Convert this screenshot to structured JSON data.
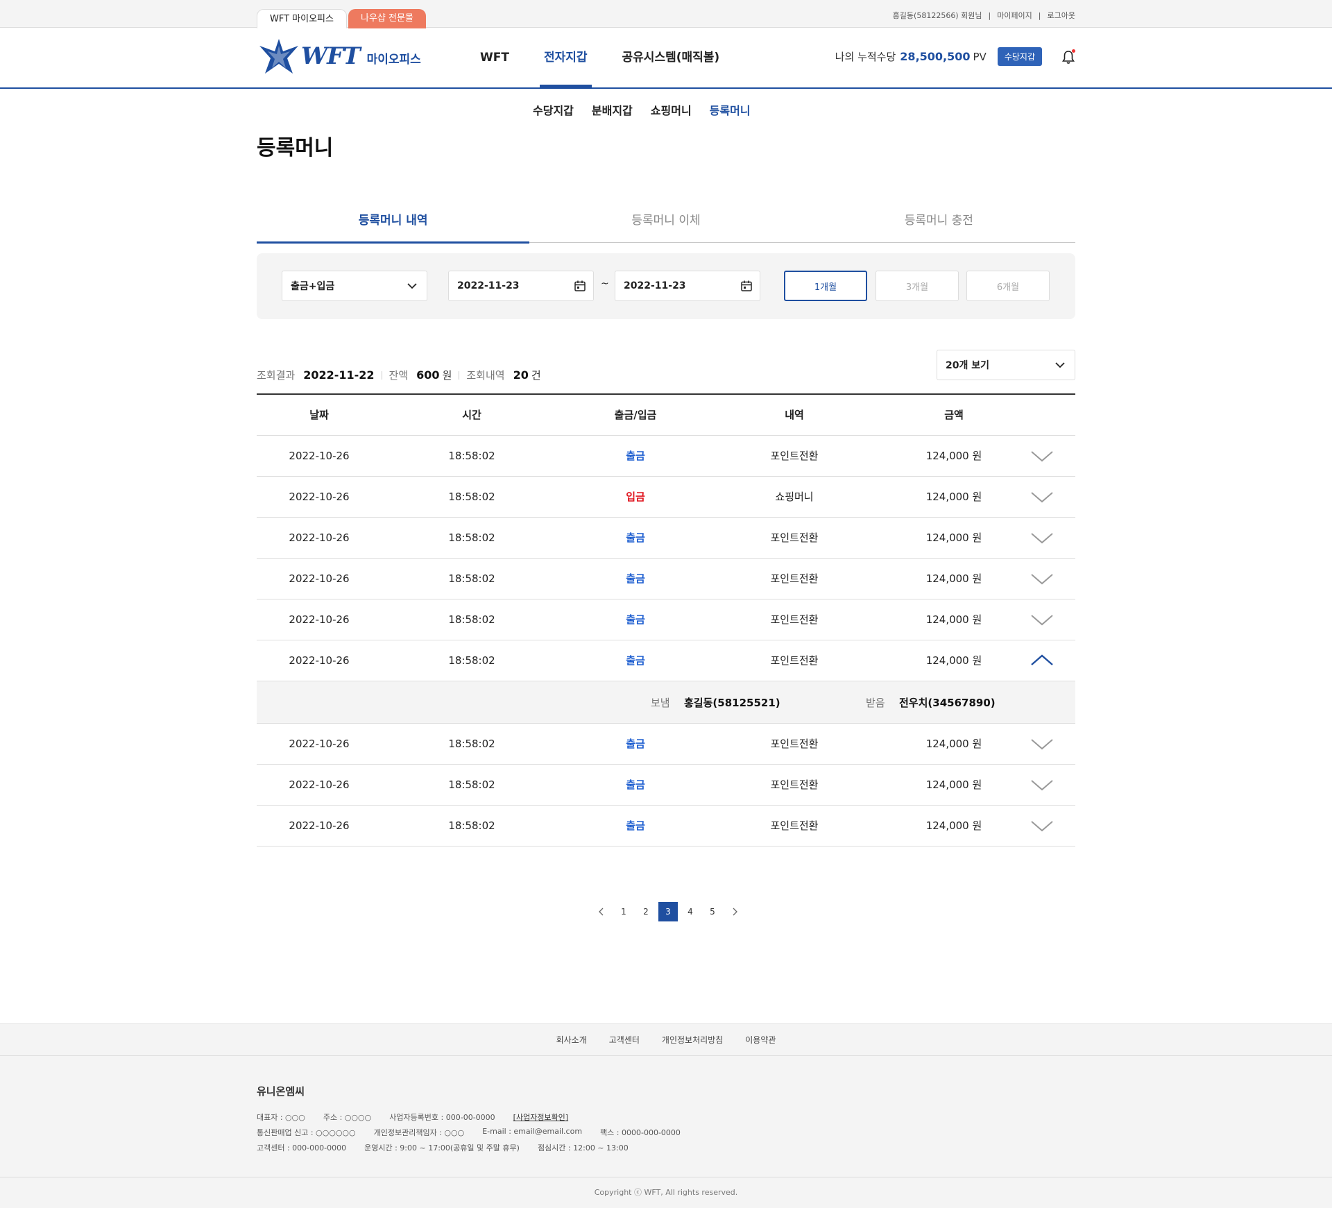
{
  "topbar": {
    "site_tabs": [
      "WFT 마이오피스",
      "나우샵 전문몰"
    ],
    "user": "홍길동(58122566) 회원님",
    "mypage": "마이페이지",
    "logout": "로그아웃"
  },
  "header": {
    "logo_word": "WFT",
    "logo_sub": "마이오피스",
    "gnb": [
      "WFT",
      "전자지갑",
      "공유시스템(매직볼)"
    ],
    "accum_label": "나의 누적수당",
    "accum_value": "28,500,500",
    "accum_unit": "PV",
    "wallet_button": "수당지갑"
  },
  "subnav": [
    "수당지갑",
    "분배지갑",
    "쇼핑머니",
    "등록머니"
  ],
  "page_title": "등록머니",
  "content_tabs": [
    "등록머니 내역",
    "등록머니 이체",
    "등록머니 충전"
  ],
  "filter": {
    "type_select": "출금+입금",
    "date_from": "2022-11-23",
    "tilde": "~",
    "date_to": "2022-11-23",
    "periods": [
      "1개월",
      "3개월",
      "6개월"
    ]
  },
  "summary": {
    "result_label": "조회결과",
    "result_date": "2022-11-22",
    "balance_label": "잔액",
    "balance_value": "600",
    "balance_unit": "원",
    "count_label": "조회내역",
    "count_value": "20",
    "count_unit": "건",
    "per_page": "20개 보기"
  },
  "table": {
    "headers": [
      "날짜",
      "시간",
      "출금/입금",
      "내역",
      "금액"
    ],
    "rows": [
      {
        "date": "2022-10-26",
        "time": "18:58:02",
        "type": "출금",
        "desc": "포인트전환",
        "amount": "124,000 원"
      },
      {
        "date": "2022-10-26",
        "time": "18:58:02",
        "type": "입금",
        "desc": "쇼핑머니",
        "amount": "124,000 원"
      },
      {
        "date": "2022-10-26",
        "time": "18:58:02",
        "type": "출금",
        "desc": "포인트전환",
        "amount": "124,000 원"
      },
      {
        "date": "2022-10-26",
        "time": "18:58:02",
        "type": "출금",
        "desc": "포인트전환",
        "amount": "124,000 원"
      },
      {
        "date": "2022-10-26",
        "time": "18:58:02",
        "type": "출금",
        "desc": "포인트전환",
        "amount": "124,000 원"
      },
      {
        "date": "2022-10-26",
        "time": "18:58:02",
        "type": "출금",
        "desc": "포인트전환",
        "amount": "124,000 원"
      },
      {
        "date": "2022-10-26",
        "time": "18:58:02",
        "type": "출금",
        "desc": "포인트전환",
        "amount": "124,000 원"
      },
      {
        "date": "2022-10-26",
        "time": "18:58:02",
        "type": "출금",
        "desc": "포인트전환",
        "amount": "124,000 원"
      },
      {
        "date": "2022-10-26",
        "time": "18:58:02",
        "type": "출금",
        "desc": "포인트전환",
        "amount": "124,000 원"
      }
    ],
    "detail": {
      "sender_label": "보냄",
      "sender": "홍길동(58125521)",
      "receiver_label": "받음",
      "receiver": "전우치(34567890)"
    }
  },
  "pagination": [
    "1",
    "2",
    "3",
    "4",
    "5"
  ],
  "footer": {
    "links": [
      "회사소개",
      "고객센터",
      "개인정보처리방침",
      "이용약관"
    ],
    "company": "유니온엠씨",
    "line1": [
      "대표자 : ○○○",
      "주소 : ○○○○",
      "사업자등록번호 : 000-00-0000",
      "[사업자정보확인]"
    ],
    "line2": [
      "통신판매업 신고 : ○○○○○○",
      "개인정보관리책임자 : ○○○",
      "E-mail : email@email.com",
      "팩스 : 0000-000-0000"
    ],
    "line3": [
      "고객센터 : 000-000-0000",
      "운영시간 : 9:00 ~ 17:00(공휴일 및 주말 휴무)",
      "점심시간 : 12:00 ~ 13:00"
    ],
    "copyright": "Copyright ⓒ WFT,  All rights reserved."
  },
  "colors": {
    "brand": "#1f4fa0",
    "withdraw": "#1f5fd0",
    "deposit": "#e0141e",
    "site_tab_alt": "#ee7a5f"
  }
}
